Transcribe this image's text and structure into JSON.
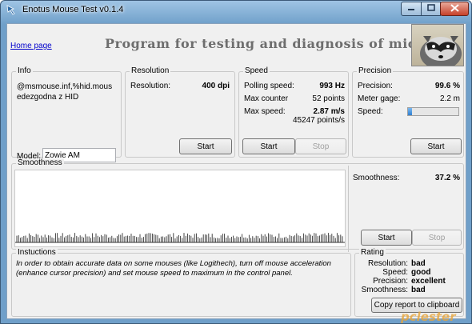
{
  "window": {
    "title": "Enotus Mouse Test v0.1.4"
  },
  "header": {
    "home_link": "Home page",
    "heading": "Program for testing and diagnosis of mice"
  },
  "info": {
    "title": "Info",
    "text": "@msmouse.inf,%hid.mousedezgodna z HID",
    "model_label": "Model:",
    "model_value": "Zowie AM"
  },
  "resolution": {
    "title": "Resolution",
    "label": "Resolution:",
    "value": "400 dpi",
    "start_label": "Start"
  },
  "speed": {
    "title": "Speed",
    "polling_label": "Polling speed:",
    "polling_value": "993 Hz",
    "max_counter_label": "Max counter",
    "max_counter_value": "52 points",
    "max_speed_label": "Max  speed:",
    "max_speed_value": "2.87 m/s",
    "max_speed_points": "45247 points/s",
    "start_label": "Start",
    "stop_label": "Stop"
  },
  "precision": {
    "title": "Precision",
    "precision_label": "Precision:",
    "precision_value": "99.6 %",
    "meter_label": "Meter gage:",
    "meter_value": "2.2 m",
    "speed_label": "Speed:",
    "speed_level": 0.08,
    "start_label": "Start"
  },
  "smoothness": {
    "title": "Smoothness",
    "label": "Smoothness:",
    "value": "37.2 %",
    "start_label": "Start",
    "stop_label": "Stop"
  },
  "instructions": {
    "title": "Instuctions",
    "text": "In order to obtain accurate data on some mouses (like Logithech), turn off mouse acceleration (enhance cursor precision) and set mouse speed to maximum in the control panel."
  },
  "rating": {
    "title": "Rating",
    "rows": [
      {
        "label": "Resolution:",
        "value": "bad"
      },
      {
        "label": "Speed:",
        "value": "good"
      },
      {
        "label": "Precision:",
        "value": "excellent"
      },
      {
        "label": "Smoothness:",
        "value": "bad"
      }
    ],
    "copy_label": "Copy report to clipboard"
  },
  "watermark": "pclester",
  "icons": {
    "app": "mouse-app-icon",
    "minimize": "minimize-icon",
    "maximize": "maximize-icon",
    "close": "close-icon"
  },
  "colors": {
    "title_bar": "#6f9fc9",
    "close_button": "#c7412a",
    "meter_fill": "#2f7fd0",
    "link": "#0000cc"
  }
}
